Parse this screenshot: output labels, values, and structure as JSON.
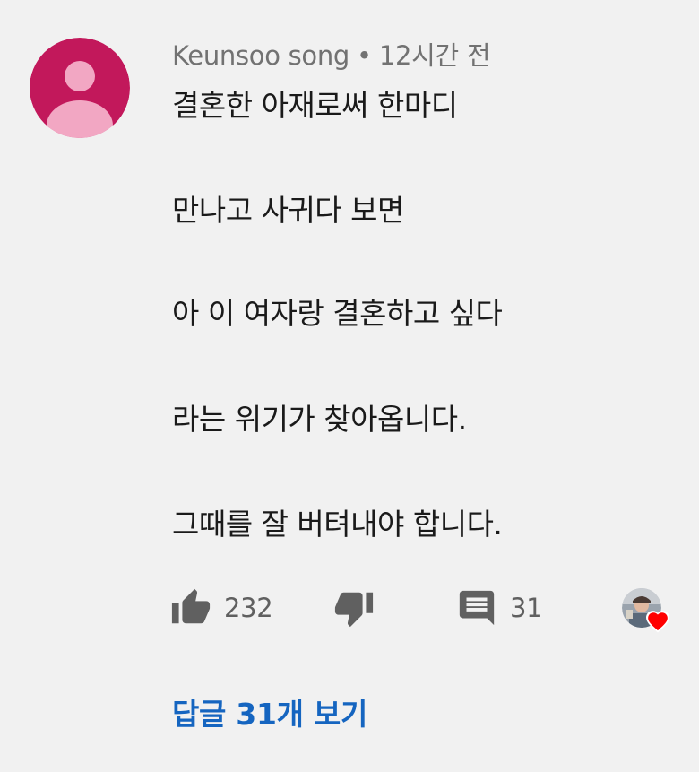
{
  "comment": {
    "author": "Keunsoo song",
    "separator": "•",
    "timestamp": "12시간 전",
    "avatar_color": "#c2185b",
    "lines": [
      "결혼한 아재로써 한마디",
      "만나고 사귀다 보면",
      "아 이 여자랑 결혼하고 싶다",
      "라는 위기가 찾아옵니다.",
      "그때를 잘 버텨내야 합니다."
    ]
  },
  "actions": {
    "like_icon": "thumb-up-icon",
    "like_count": "232",
    "dislike_icon": "thumb-down-icon",
    "reply_icon": "comment-icon",
    "reply_count": "31",
    "heart_icon": "heart-icon",
    "heart_color": "#ff0000"
  },
  "replies": {
    "label": "답글 31개 보기",
    "link_color": "#1565c0"
  }
}
